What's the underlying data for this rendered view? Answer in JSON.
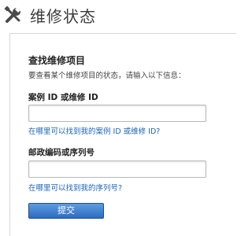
{
  "header": {
    "title": "维修状态",
    "icon": "tools-icon"
  },
  "form": {
    "section_title": "查找维修项目",
    "instructions": "要查看某个维修项目的状态，请输入以下信息：",
    "case_field": {
      "label": "案例 ID 或维修 ID",
      "value": "",
      "help_link": "在哪里可以找到我的案例 ID 或维修 ID?"
    },
    "postal_field": {
      "label": "邮政编码或序列号",
      "value": "",
      "help_link": "在哪里可以找到我的序列号?"
    },
    "submit_label": "提交"
  },
  "colors": {
    "link": "#1a64b7",
    "button": "#2f6cc0"
  }
}
